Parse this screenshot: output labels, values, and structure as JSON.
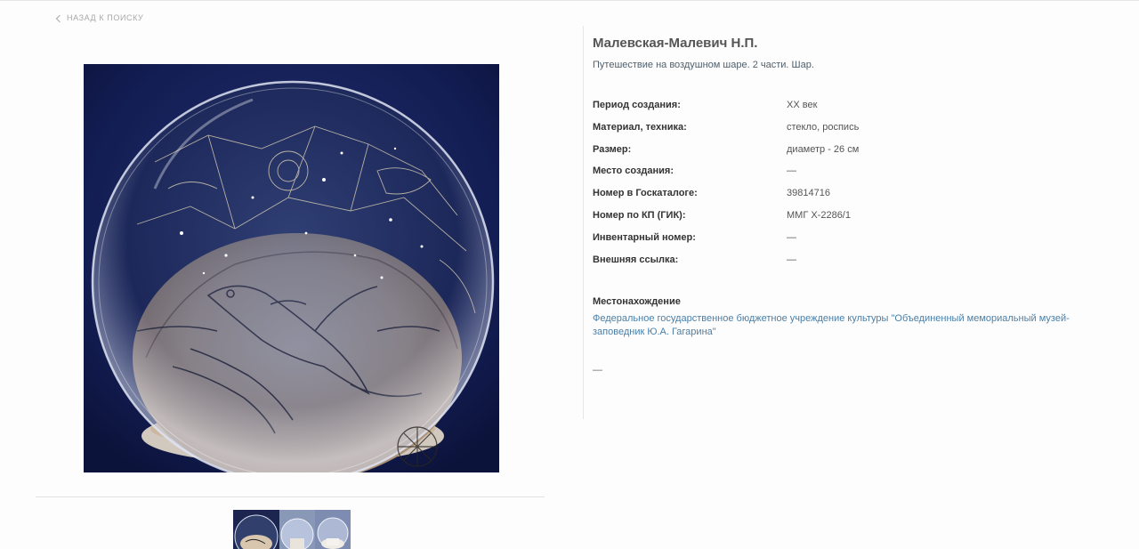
{
  "nav": {
    "back_label": "НАЗАД К ПОИСКУ"
  },
  "object": {
    "author": "Малевская-Малевич Н.П.",
    "title": "Путешествие на воздушном шаре. 2 части. Шар."
  },
  "properties": [
    {
      "label": "Период создания:",
      "value": "XX век"
    },
    {
      "label": "Материал, техника:",
      "value": "стекло, роспись"
    },
    {
      "label": "Размер:",
      "value": "диаметр - 26 см"
    },
    {
      "label": "Место создания:",
      "value": "—"
    },
    {
      "label": "Номер в Госкаталоге:",
      "value": "39814716"
    },
    {
      "label": "Номер по КП (ГИК):",
      "value": "ММГ Х-2286/1"
    },
    {
      "label": "Инвентарный номер:",
      "value": "—"
    },
    {
      "label": "Внешняя ссылка:",
      "value": "—"
    }
  ],
  "location": {
    "heading": "Местонахождение",
    "link": "Федеральное государственное бюджетное учреждение культуры \"Объединенный мемориальный музей-заповедник Ю.А. Гагарина\"",
    "extra": "—"
  },
  "colors": {
    "link": "#4a7fa8",
    "photo_background": "#1b2550"
  },
  "gallery": {
    "thumbnail_count": 3,
    "selected_index": 0
  }
}
